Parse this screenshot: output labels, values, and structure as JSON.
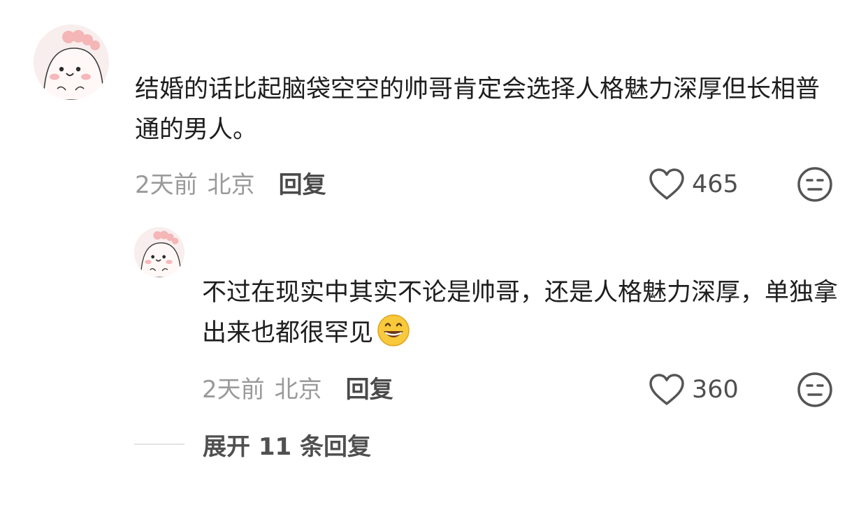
{
  "colors": {
    "background": "#ffffff",
    "text": "#1e1e1e",
    "meta": "#9a9a9a",
    "reply_action": "#4a4a4a",
    "icon": "#555555"
  },
  "comment": {
    "avatar_icon": "cartoon-avatar",
    "text": "结婚的话比起脑袋空空的帅哥肯定会选择人格魅力深厚但长相普通的男人。",
    "time": "2天前",
    "location": "北京",
    "reply_label": "回复",
    "likes": "465",
    "like_icon": "heart-icon",
    "dislike_icon": "dislike-face-icon"
  },
  "reply": {
    "avatar_icon": "cartoon-avatar",
    "text": "不过在现实中其实不论是帅哥，还是人格魅力深厚，单独拿出来也都很罕见",
    "emoji": "grinning-face-emoji",
    "time": "2天前",
    "location": "北京",
    "reply_label": "回复",
    "likes": "360",
    "like_icon": "heart-icon",
    "dislike_icon": "dislike-face-icon"
  },
  "expand": {
    "label": "展开 11 条回复"
  }
}
